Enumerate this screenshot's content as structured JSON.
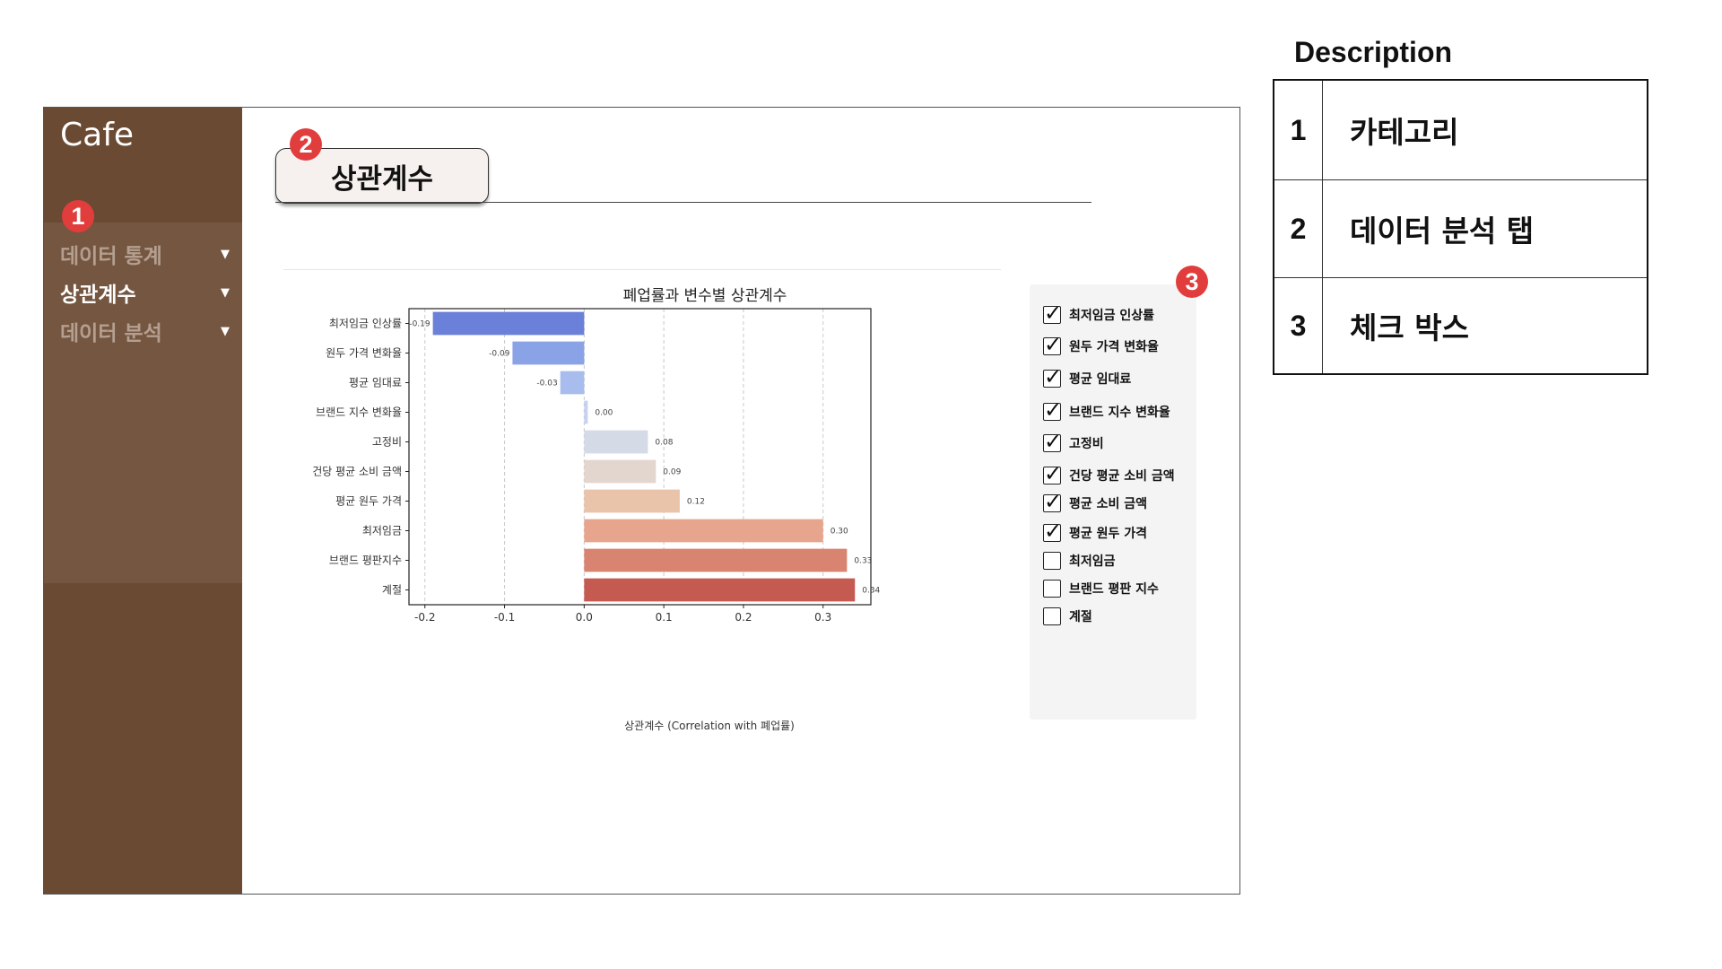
{
  "sidebar": {
    "brand": "Cafe",
    "items": [
      {
        "label": "데이터 통계",
        "caret": "▼",
        "active": false
      },
      {
        "label": "상관계수",
        "caret": "▼",
        "active": true
      },
      {
        "label": "데이터 분석",
        "caret": "▼",
        "active": false
      }
    ]
  },
  "markers": [
    "1",
    "2",
    "3"
  ],
  "tab": {
    "title": "상관계수"
  },
  "chart_data": {
    "type": "bar",
    "orientation": "horizontal",
    "title": "폐업률과 변수별 상관계수",
    "xlabel": "상관계수 (Correlation with 폐업률)",
    "ylabel": "",
    "xlim": [
      -0.22,
      0.36
    ],
    "xticks": [
      -0.2,
      -0.1,
      0.0,
      0.1,
      0.2,
      0.3
    ],
    "xtick_labels": [
      "-0.2",
      "-0.1",
      "0.0",
      "0.1",
      "0.2",
      "0.3"
    ],
    "grid": "x-dashed",
    "categories": [
      "최저임금 인상률",
      "원두 가격 변화율",
      "평균 임대료",
      "브랜드 지수 변화율",
      "고정비",
      "건당 평균 소비 금액",
      "평균 원두 가격",
      "최저임금",
      "브랜드 평판지수",
      "계절"
    ],
    "values": [
      -0.19,
      -0.09,
      -0.03,
      0.0,
      0.08,
      0.09,
      0.12,
      0.3,
      0.33,
      0.34
    ],
    "value_labels": [
      "-0.19",
      "-0.09",
      "-0.03",
      "0.00",
      "0.08",
      "0.09",
      "0.12",
      "0.30",
      "0.33",
      "0.34"
    ],
    "colors": [
      "#6b80d8",
      "#8aa2e6",
      "#a9bcee",
      "#c6d2f0",
      "#d4dae6",
      "#e3d6cf",
      "#eac3ab",
      "#e6a58c",
      "#d98470",
      "#c45a50"
    ]
  },
  "checkboxes": [
    {
      "label": "최저임금 인상률",
      "checked": true
    },
    {
      "label": "원두 가격 변화율",
      "checked": true
    },
    {
      "label": "평균 임대료",
      "checked": true
    },
    {
      "label": "브랜드 지수 변화율",
      "checked": true
    },
    {
      "label": "고정비",
      "checked": true
    },
    {
      "label": "건당 평균 소비 금액",
      "checked": true
    },
    {
      "label": "평균 소비 금액",
      "checked": true
    },
    {
      "label": "평균 원두 가격",
      "checked": true
    },
    {
      "label": "최저임금",
      "checked": false
    },
    {
      "label": "브랜드 평판 지수",
      "checked": false
    },
    {
      "label": "계절",
      "checked": false
    }
  ],
  "description": {
    "title": "Description",
    "rows": [
      {
        "num": "1",
        "text": "카테고리"
      },
      {
        "num": "2",
        "text": "데이터 분석 탭"
      },
      {
        "num": "3",
        "text": "체크 박스"
      }
    ]
  }
}
